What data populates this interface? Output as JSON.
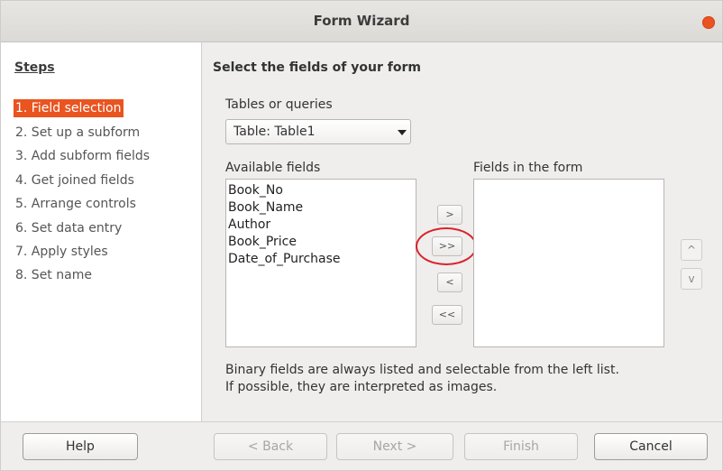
{
  "window": {
    "title": "Form Wizard"
  },
  "steps": {
    "heading": "Steps",
    "items": [
      {
        "label": "1. Field selection"
      },
      {
        "label": "2. Set up a subform"
      },
      {
        "label": "3. Add subform fields"
      },
      {
        "label": "4. Get joined fields"
      },
      {
        "label": "5. Arrange controls"
      },
      {
        "label": "6. Set data entry"
      },
      {
        "label": "7. Apply styles"
      },
      {
        "label": "8. Set name"
      }
    ],
    "active_index": 0
  },
  "main": {
    "heading": "Select the fields of your form",
    "tables_label": "Tables or queries",
    "table_selected": "Table: Table1",
    "available_label": "Available fields",
    "form_fields_label": "Fields in the form",
    "available_fields": [
      "Book_No",
      "Book_Name",
      "Author",
      "Book_Price",
      "Date_of_Purchase"
    ],
    "form_fields": [],
    "move_buttons": {
      "add_one": ">",
      "add_all": ">>",
      "remove_one": "<",
      "remove_all": "<<"
    },
    "order_buttons": {
      "up": "^",
      "down": "v"
    },
    "info_line1": "Binary fields are always listed and selectable from the left list.",
    "info_line2": "If possible, they are interpreted as images."
  },
  "footer": {
    "help": "Help",
    "back": "< Back",
    "next": "Next >",
    "finish": "Finish",
    "cancel": "Cancel"
  },
  "colors": {
    "accent": "#e95420",
    "highlight_ring": "#d9232d"
  }
}
